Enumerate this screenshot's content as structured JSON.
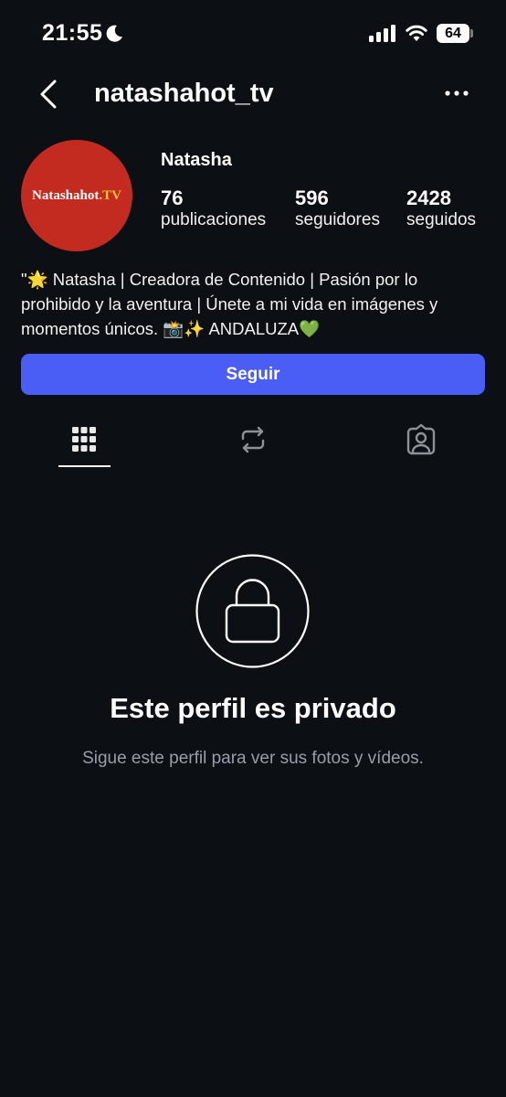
{
  "status_bar": {
    "time": "21:55",
    "battery": "64",
    "icons": [
      "moon-icon",
      "signal-icon",
      "wifi-icon",
      "battery-icon"
    ]
  },
  "header": {
    "username": "natashahot_tv",
    "back_icon": "chevron-left-icon",
    "more_icon": "more-horizontal-icon"
  },
  "profile": {
    "avatar_text": "Natashahot",
    "avatar_text_accent": ".TV",
    "name": "Natasha",
    "stats": [
      {
        "value": "76",
        "label": "publicaciones"
      },
      {
        "value": "596",
        "label": "seguidores"
      },
      {
        "value": "2428",
        "label": "seguidos"
      }
    ],
    "bio_line1": "\"🌟 Natasha | Creadora de Contenido | Pasión por lo",
    "bio_line2": "prohibido y la aventura | Únete a mi vida en imágenes y",
    "bio_line3": "momentos únicos. 📸✨ ANDALUZA💚",
    "follow_label": "Seguir"
  },
  "tabs": [
    {
      "icon": "grid-icon",
      "active": true
    },
    {
      "icon": "reels-repost-icon",
      "active": false
    },
    {
      "icon": "tagged-user-icon",
      "active": false
    }
  ],
  "private": {
    "icon": "lock-icon",
    "title": "Este perfil es privado",
    "subtitle": "Sigue este perfil para ver sus fotos y vídeos."
  },
  "colors": {
    "background": "#0c0f14",
    "button": "#4a5df5",
    "avatar": "#c32b21"
  }
}
